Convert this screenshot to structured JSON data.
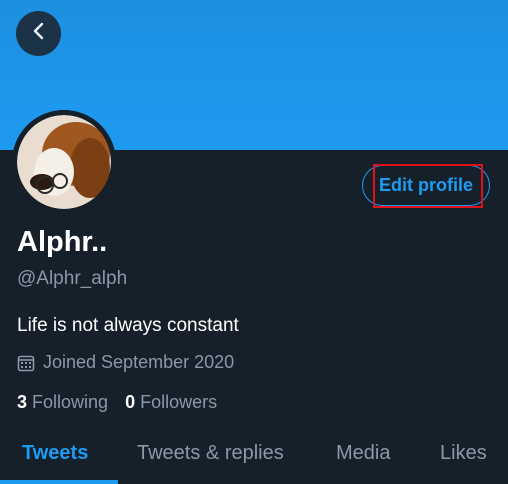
{
  "header": {
    "back_icon": "chevron-left-icon"
  },
  "profile": {
    "name": "Alphr..",
    "handle": "@Alphr_alph",
    "bio": "Life is not always constant",
    "joined": "Joined September 2020",
    "calendar_icon": "calendar-icon",
    "edit_label": "Edit profile"
  },
  "stats": {
    "following_count": "3",
    "following_label": "Following",
    "followers_count": "0",
    "followers_label": "Followers"
  },
  "tabs": [
    {
      "label": "Tweets",
      "active": true
    },
    {
      "label": "Tweets & replies",
      "active": false
    },
    {
      "label": "Media",
      "active": false
    },
    {
      "label": "Likes",
      "active": false
    }
  ],
  "colors": {
    "background": "#15202b",
    "accent": "#1d9bf0",
    "secondary_text": "#8b98a5",
    "highlight": "#e0101b"
  }
}
